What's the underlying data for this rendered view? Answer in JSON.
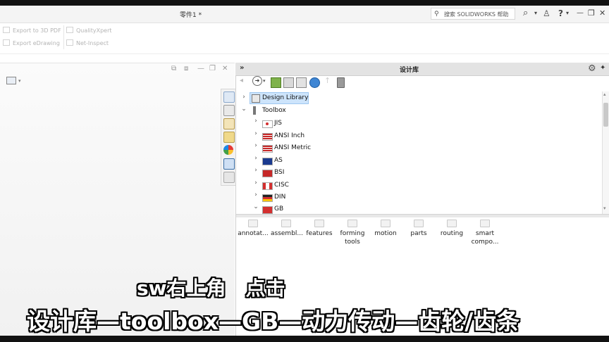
{
  "window": {
    "title": "零件1 *"
  },
  "search": {
    "placeholder": "搜索 SOLIDWORKS 帮助"
  },
  "title_icons": {
    "search": "⌕",
    "search_menu": "▾",
    "user": "♙",
    "help": "?",
    "help_menu": "▾",
    "minimize": "—",
    "restore": "❐",
    "close": "✕"
  },
  "ribbon": {
    "items": [
      "Export to 3D PDF",
      "Export eDrawing",
      "QualityXpert",
      "Net-Inspect"
    ]
  },
  "graphics": {
    "view_menu": "▾"
  },
  "window_buttons": {
    "b1": "⧉",
    "b2": "⧈",
    "min": "—",
    "restore": "❐",
    "close": "✕"
  },
  "taskpane": {
    "title": "设计库",
    "expand": "»",
    "gear": "⚙",
    "pin": "✦",
    "toolbar": {
      "back": "◂",
      "forward": "➜",
      "forward_menu": "▾",
      "up": "↑"
    },
    "tree": [
      {
        "label": "Design Library",
        "chev": "›"
      },
      {
        "label": "Toolbox",
        "chev": "⌄"
      },
      {
        "label": "JIS",
        "chev": "›"
      },
      {
        "label": "ANSI Inch",
        "chev": "›"
      },
      {
        "label": "ANSI Metric",
        "chev": "›"
      },
      {
        "label": "AS",
        "chev": "›"
      },
      {
        "label": "BSI",
        "chev": "›"
      },
      {
        "label": "CISC",
        "chev": "›"
      },
      {
        "label": "DIN",
        "chev": "›"
      },
      {
        "label": "GB",
        "chev": "⌄"
      }
    ],
    "scroll": {
      "up": "▴",
      "down": "▾"
    },
    "folders": [
      {
        "line1": "annotat...",
        "line2": ""
      },
      {
        "line1": "assembl...",
        "line2": ""
      },
      {
        "line1": "features",
        "line2": ""
      },
      {
        "line1": "forming",
        "line2": "tools"
      },
      {
        "line1": "motion",
        "line2": ""
      },
      {
        "line1": "parts",
        "line2": ""
      },
      {
        "line1": "routing",
        "line2": ""
      },
      {
        "line1": "smart",
        "line2": "compo..."
      }
    ]
  },
  "subtitle": {
    "line1": "sw右上角　点击",
    "line2": "设计库—toolbox—GB—动力传动—齿轮/齿条"
  },
  "colors": {
    "subtitle_fill": "#ffffff",
    "subtitle_stroke": "#000000",
    "pane_header": "#e3e3e3",
    "accent_blue": "#1f6fc6"
  }
}
